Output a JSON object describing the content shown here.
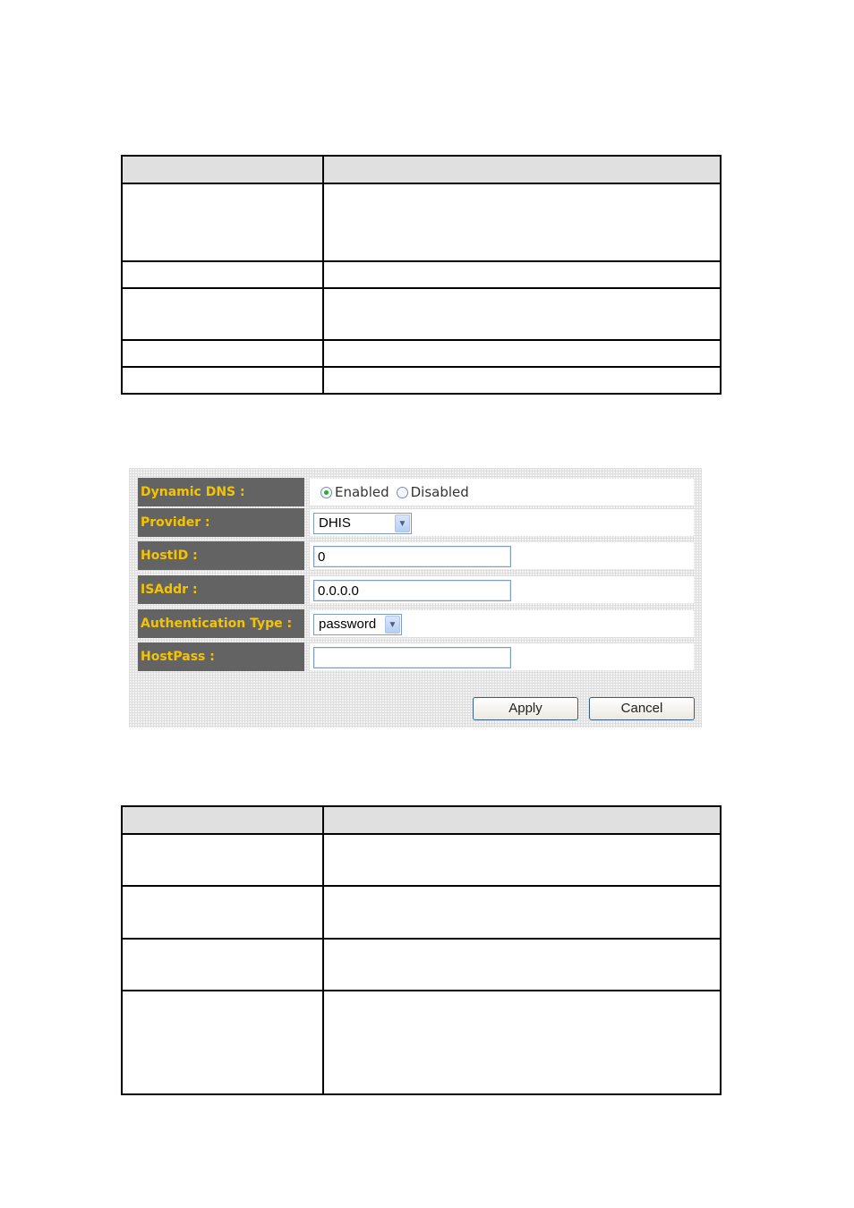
{
  "table1": {
    "header": [
      "",
      ""
    ],
    "rows": [
      [
        "",
        ""
      ],
      [
        "",
        ""
      ],
      [
        "",
        ""
      ],
      [
        "",
        ""
      ],
      [
        "",
        ""
      ]
    ]
  },
  "form": {
    "dynamic_dns": {
      "label": "Dynamic DNS :",
      "options": [
        {
          "label": "Enabled",
          "selected": true
        },
        {
          "label": "Disabled",
          "selected": false
        }
      ]
    },
    "provider": {
      "label": "Provider :",
      "value": "DHIS"
    },
    "hostid": {
      "label": "HostID :",
      "value": "0"
    },
    "isaddr": {
      "label": "ISAddr :",
      "value": "0.0.0.0"
    },
    "auth_type": {
      "label": "Authentication Type :",
      "value": "password"
    },
    "hostpass": {
      "label": "HostPass :",
      "value": ""
    },
    "apply_label": "Apply",
    "cancel_label": "Cancel",
    "colors": {
      "label_bg": "#636363",
      "label_text": "#f5c400",
      "input_border": "#7f9db9"
    }
  },
  "table2": {
    "header": [
      "",
      ""
    ],
    "rows": [
      [
        "",
        ""
      ],
      [
        "",
        ""
      ],
      [
        "",
        ""
      ],
      [
        "",
        ""
      ]
    ]
  }
}
